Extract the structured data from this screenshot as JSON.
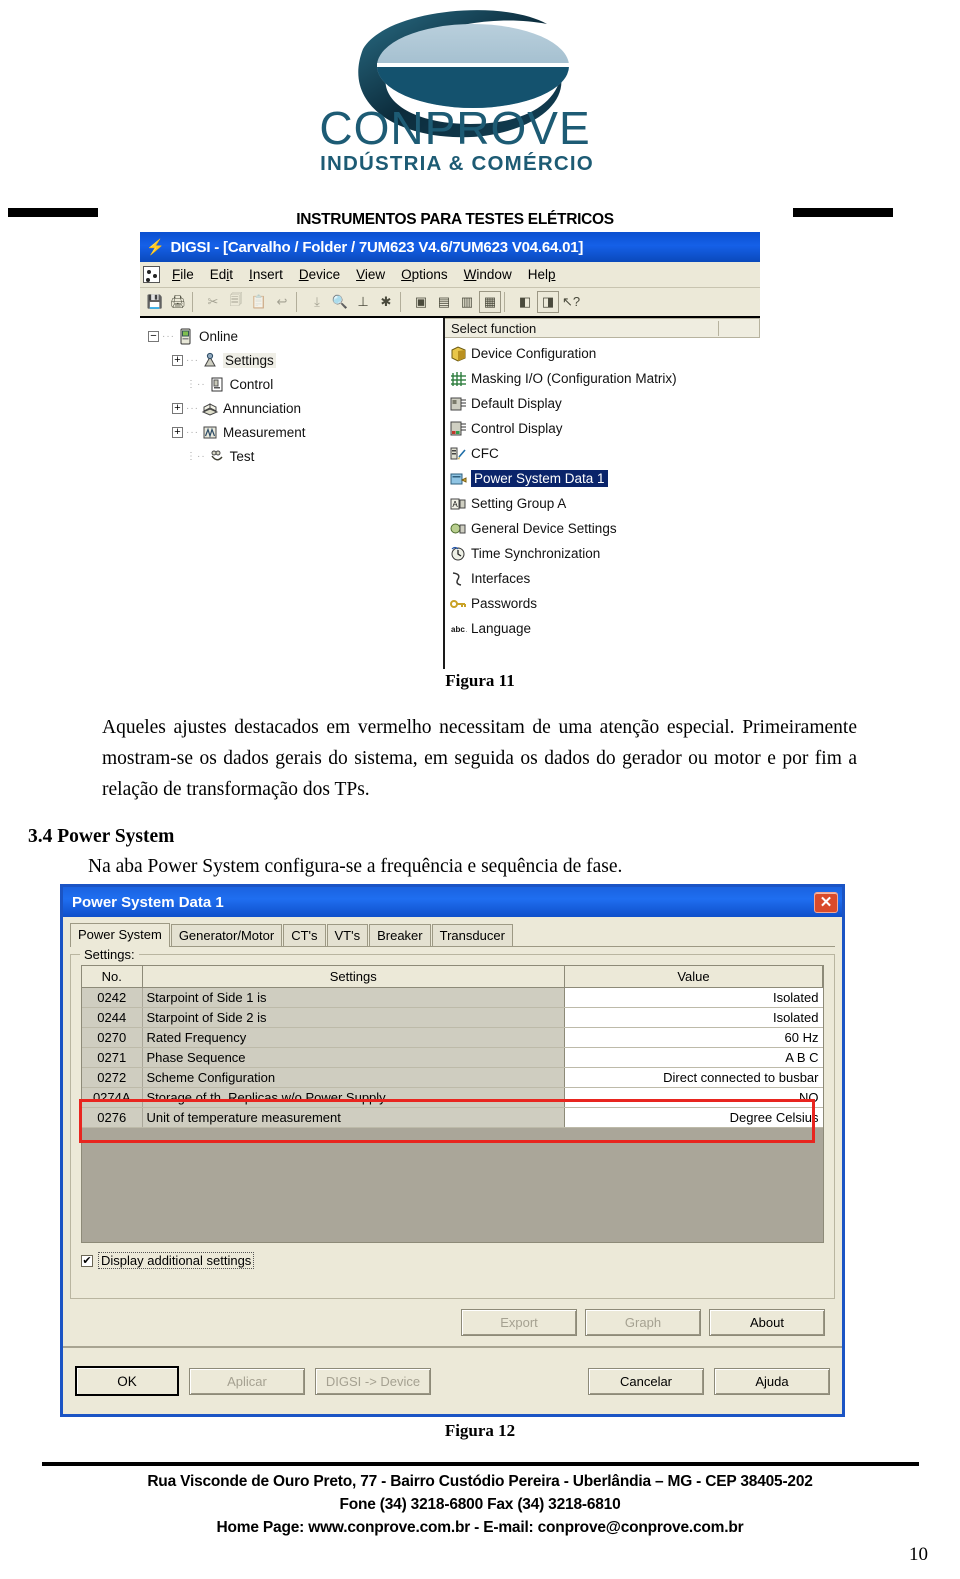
{
  "logo": {
    "name": "CONPROVE",
    "subtitle": "INDÚSTRIA & COMÉRCIO"
  },
  "header": {
    "banner": "INSTRUMENTOS PARA TESTES ELÉTRICOS"
  },
  "digsi": {
    "title": "DIGSI - [Carvalho / Folder / 7UM623 V4.6/7UM623 V04.64.01]",
    "menu": [
      "File",
      "Edit",
      "Insert",
      "Device",
      "View",
      "Options",
      "Window",
      "Help"
    ],
    "tree": [
      {
        "label": "Online",
        "expander": "-",
        "level": 0,
        "icon": "device-icon",
        "highlight": false
      },
      {
        "label": "Settings",
        "expander": "+",
        "level": 1,
        "icon": "settings-icon",
        "highlight": true
      },
      {
        "label": "Control",
        "expander": "",
        "level": 1,
        "icon": "control-icon",
        "highlight": false
      },
      {
        "label": "Annunciation",
        "expander": "+",
        "level": 1,
        "icon": "annunciation-icon",
        "highlight": false
      },
      {
        "label": "Measurement",
        "expander": "+",
        "level": 1,
        "icon": "measurement-icon",
        "highlight": false
      },
      {
        "label": "Test",
        "expander": "",
        "level": 1,
        "icon": "test-icon",
        "highlight": false
      }
    ],
    "function_header": "Select function",
    "functions": [
      {
        "label": "Device Configuration",
        "icon": "cube-icon",
        "selected": false
      },
      {
        "label": "Masking I/O (Configuration Matrix)",
        "icon": "matrix-icon",
        "selected": false
      },
      {
        "label": "Default Display",
        "icon": "display-icon",
        "selected": false
      },
      {
        "label": "Control Display",
        "icon": "ctrl-display-icon",
        "selected": false
      },
      {
        "label": "CFC",
        "icon": "cfc-icon",
        "selected": false
      },
      {
        "label": "Power System Data 1",
        "icon": "psd-icon",
        "selected": true
      },
      {
        "label": "Setting Group A",
        "icon": "group-a-icon",
        "selected": false
      },
      {
        "label": "General Device Settings",
        "icon": "general-icon",
        "selected": false
      },
      {
        "label": "Time Synchronization",
        "icon": "clock-icon",
        "selected": false
      },
      {
        "label": "Interfaces",
        "icon": "interface-icon",
        "selected": false
      },
      {
        "label": "Passwords",
        "icon": "key-icon",
        "selected": false
      },
      {
        "label": "Language",
        "icon": "abc-icon",
        "selected": false
      }
    ]
  },
  "doc": {
    "figura11": "Figura 11",
    "paragraph": "Aqueles ajustes destacados em vermelho necessitam de uma atenção especial. Primeiramente mostram-se os dados gerais do sistema, em seguida os dados do gerador ou motor e por fim a relação de transformação dos TPs.",
    "section_number": "3.4",
    "section_title": "Power System",
    "section_body": "Na aba Power System configura-se a frequência e sequência de fase.",
    "figura12": "Figura 12"
  },
  "dialog": {
    "title": "Power System Data 1",
    "close_label": "✕",
    "tabs": [
      {
        "label": "Power System",
        "active": true
      },
      {
        "label": "Generator/Motor",
        "active": false
      },
      {
        "label": "CT's",
        "active": false
      },
      {
        "label": "VT's",
        "active": false
      },
      {
        "label": "Breaker",
        "active": false
      },
      {
        "label": "Transducer",
        "active": false
      }
    ],
    "group_legend": "Settings:",
    "columns": [
      "No.",
      "Settings",
      "Value"
    ],
    "rows": [
      {
        "no": "0242",
        "setting": "Starpoint of Side 1 is",
        "value": "Isolated",
        "highlight": false
      },
      {
        "no": "0244",
        "setting": "Starpoint of Side 2 is",
        "value": "Isolated",
        "highlight": false
      },
      {
        "no": "0270",
        "setting": "Rated Frequency",
        "value": "60 Hz",
        "highlight": true
      },
      {
        "no": "0271",
        "setting": "Phase Sequence",
        "value": "A B C",
        "highlight": true
      },
      {
        "no": "0272",
        "setting": "Scheme Configuration",
        "value": "Direct connected to busbar",
        "highlight": false
      },
      {
        "no": "0274A",
        "setting": "Storage of th. Replicas w/o Power Supply",
        "value": "NO",
        "highlight": false
      },
      {
        "no": "0276",
        "setting": "Unit of temperature measurement",
        "value": "Degree Celsius",
        "highlight": false
      }
    ],
    "checkbox": {
      "label": "Display additional settings",
      "checked": true
    },
    "mid_buttons": [
      {
        "label": "Export",
        "enabled": false
      },
      {
        "label": "Graph",
        "enabled": false
      },
      {
        "label": "About",
        "enabled": true
      }
    ],
    "footer_buttons_left": [
      {
        "label": "OK",
        "enabled": true
      },
      {
        "label": "Aplicar",
        "enabled": false
      },
      {
        "label": "DIGSI -> Device",
        "enabled": false
      }
    ],
    "footer_buttons_right": [
      {
        "label": "Cancelar",
        "enabled": true
      },
      {
        "label": "Ajuda",
        "enabled": true
      }
    ]
  },
  "footer": {
    "line1": "Rua Visconde de Ouro Preto, 77 -  Bairro Custódio Pereira - Uberlândia – MG -  CEP 38405-202",
    "line2": "Fone (34) 3218-6800          Fax (34) 3218-6810",
    "line3": "Home Page: www.conprove.com.br    -     E-mail: conprove@conprove.com.br",
    "page": "10"
  },
  "colors": {
    "title_blue": "#1560e8",
    "selection_blue": "#0a246a",
    "highlight_red": "#e8251f",
    "dialog_border": "#1b54c4",
    "face": "#ece9d8",
    "logo_teal": "#1d5b74"
  }
}
